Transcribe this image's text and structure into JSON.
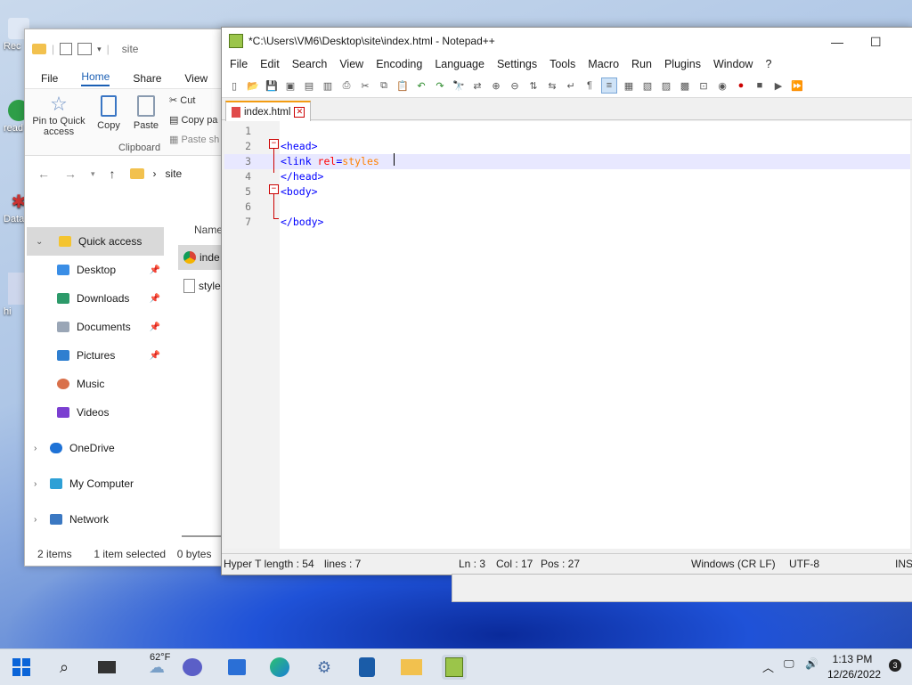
{
  "desktop": {
    "icons": [
      "Rec",
      "read",
      "Data",
      "hi"
    ]
  },
  "explorer": {
    "title": "site",
    "tabs": [
      "File",
      "Home",
      "Share",
      "View"
    ],
    "ribbon": {
      "pin_label": "Pin to Quick access",
      "copy_label": "Copy",
      "paste_label": "Paste",
      "cut_label": "Cut",
      "copy_path_label": "Copy pa",
      "paste_shortcut_label": "Paste sh",
      "group_label": "Clipboard"
    },
    "address": {
      "folder": "site"
    },
    "column_header": "Name",
    "nav": [
      {
        "label": "Quick access",
        "pinned": false
      },
      {
        "label": "Desktop",
        "pinned": true
      },
      {
        "label": "Downloads",
        "pinned": true
      },
      {
        "label": "Documents",
        "pinned": true
      },
      {
        "label": "Pictures",
        "pinned": true
      },
      {
        "label": "Music",
        "pinned": false
      },
      {
        "label": "Videos",
        "pinned": false
      },
      {
        "label": "OneDrive",
        "pinned": false
      },
      {
        "label": "My Computer",
        "pinned": false
      },
      {
        "label": "Network",
        "pinned": false
      }
    ],
    "files": [
      "inde",
      "style"
    ],
    "status": {
      "items": "2 items",
      "selected": "1 item selected",
      "size": "0 bytes"
    }
  },
  "notepad": {
    "title": "*C:\\Users\\VM6\\Desktop\\site\\index.html - Notepad++",
    "menu": [
      "File",
      "Edit",
      "Search",
      "View",
      "Encoding",
      "Language",
      "Settings",
      "Tools",
      "Macro",
      "Run",
      "Plugins",
      "Window",
      "?"
    ],
    "tab_label": "index.html",
    "lines": [
      {
        "n": "1",
        "parts": []
      },
      {
        "n": "2",
        "parts": [
          [
            "tag",
            "<head>"
          ]
        ]
      },
      {
        "n": "3",
        "parts": [
          [
            "tag",
            "<link "
          ],
          [
            "attr",
            "rel"
          ],
          [
            "tag",
            "="
          ],
          [
            "val",
            "styles"
          ]
        ]
      },
      {
        "n": "4",
        "parts": [
          [
            "tag",
            "</head>"
          ]
        ]
      },
      {
        "n": "5",
        "parts": [
          [
            "tag",
            "<body>"
          ]
        ]
      },
      {
        "n": "6",
        "parts": []
      },
      {
        "n": "7",
        "parts": [
          [
            "tag",
            "</body>"
          ]
        ]
      }
    ],
    "status": {
      "length": "Hyper T length : 54",
      "lines": "lines : 7",
      "ln": "Ln : 3",
      "col": "Col : 17",
      "pos": "Pos : 27",
      "eol": "Windows (CR LF)",
      "encoding": "UTF-8",
      "mode": "INS"
    }
  },
  "taskbar": {
    "weather": "62°F",
    "time": "1:13 PM",
    "date": "12/26/2022",
    "notifications": "3"
  }
}
